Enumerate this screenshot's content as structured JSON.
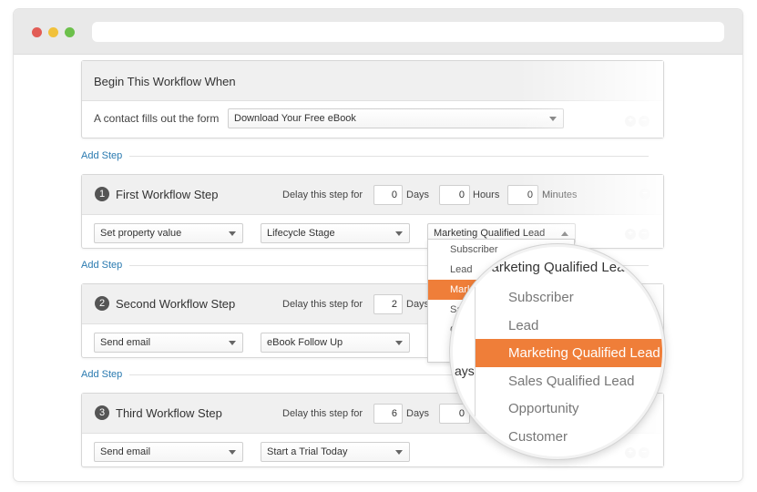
{
  "colors": {
    "accent": "#ef7e39",
    "link": "#2a7ab0",
    "dot_red": "#e25c55",
    "dot_yellow": "#f1c13b",
    "dot_green": "#6cc04b"
  },
  "trigger": {
    "title": "Begin This Workflow When",
    "label": "A contact fills out the form",
    "form_select": "Download Your Free eBook"
  },
  "add_step_label": "Add Step",
  "delay_label": "Delay this step for",
  "units": {
    "days": "Days",
    "hours": "Hours",
    "minutes": "Minutes"
  },
  "steps": [
    {
      "num": "1",
      "title": "First Workflow Step",
      "days": "0",
      "hours": "0",
      "minutes": "0",
      "action": "Set property value",
      "target": "Lifecycle Stage",
      "value": "Marketing Qualified Lead"
    },
    {
      "num": "2",
      "title": "Second Workflow Step",
      "days": "2",
      "action": "Send email",
      "target": "eBook Follow Up"
    },
    {
      "num": "3",
      "title": "Third Workflow Step",
      "days": "6",
      "hours": "0",
      "action": "Send email",
      "target": "Start a Trial Today"
    }
  ],
  "dropdown": {
    "items": [
      "Subscriber",
      "Lead",
      "Marke",
      "Sal",
      "O",
      "C"
    ],
    "active_index": 2
  },
  "magnifier": {
    "header": "Marketing Qualified Lead",
    "partial_text": "ays",
    "items": [
      "Subscriber",
      "Lead",
      "Marketing Qualified Lead",
      "Sales Qualified Lead",
      "Opportunity",
      "Customer"
    ],
    "active_index": 2
  }
}
